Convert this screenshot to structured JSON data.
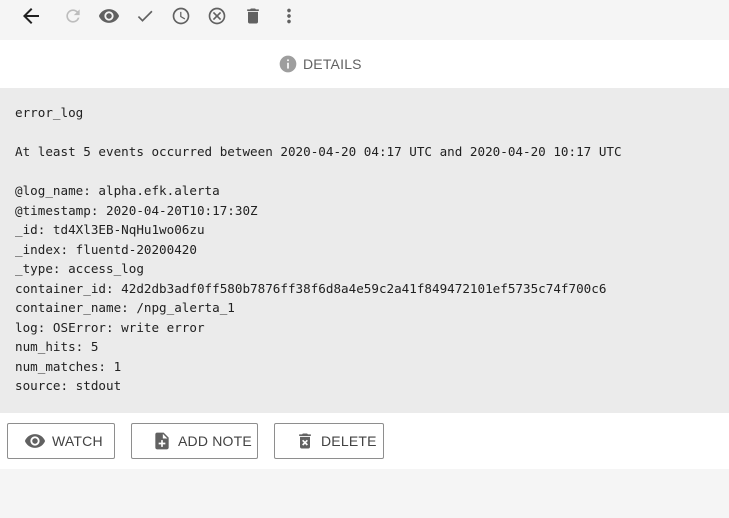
{
  "toolbar": {
    "icons": [
      "arrow-left-icon",
      "refresh-icon",
      "eye-icon",
      "check-icon",
      "clock-icon",
      "cancel-circle-icon",
      "trash-icon",
      "more-vert-icon"
    ]
  },
  "tabs": {
    "details_label": "DETAILS"
  },
  "details": {
    "title": "error_log",
    "summary": "At least 5 events occurred between 2020-04-20 04:17 UTC and 2020-04-20 10:17 UTC",
    "fields": [
      "@log_name: alpha.efk.alerta",
      "@timestamp: 2020-04-20T10:17:30Z",
      "_id: td4Xl3EB-NqHu1wo06zu",
      "_index: fluentd-20200420",
      "_type: access_log",
      "container_id: 42d2db3adf0ff580b7876ff38f6d8a4e59c2a41f849472101ef5735c74f700c6",
      "container_name: /npg_alerta_1",
      "log: OSError: write error",
      "num_hits: 5",
      "num_matches: 1",
      "source: stdout"
    ]
  },
  "actions": {
    "watch_label": "WATCH",
    "add_note_label": "ADD NOTE",
    "delete_label": "DELETE"
  },
  "colors": {
    "icon_dark": "#424242",
    "icon_disabled": "#bdbdbd",
    "info_icon": "#9e9e9e"
  }
}
